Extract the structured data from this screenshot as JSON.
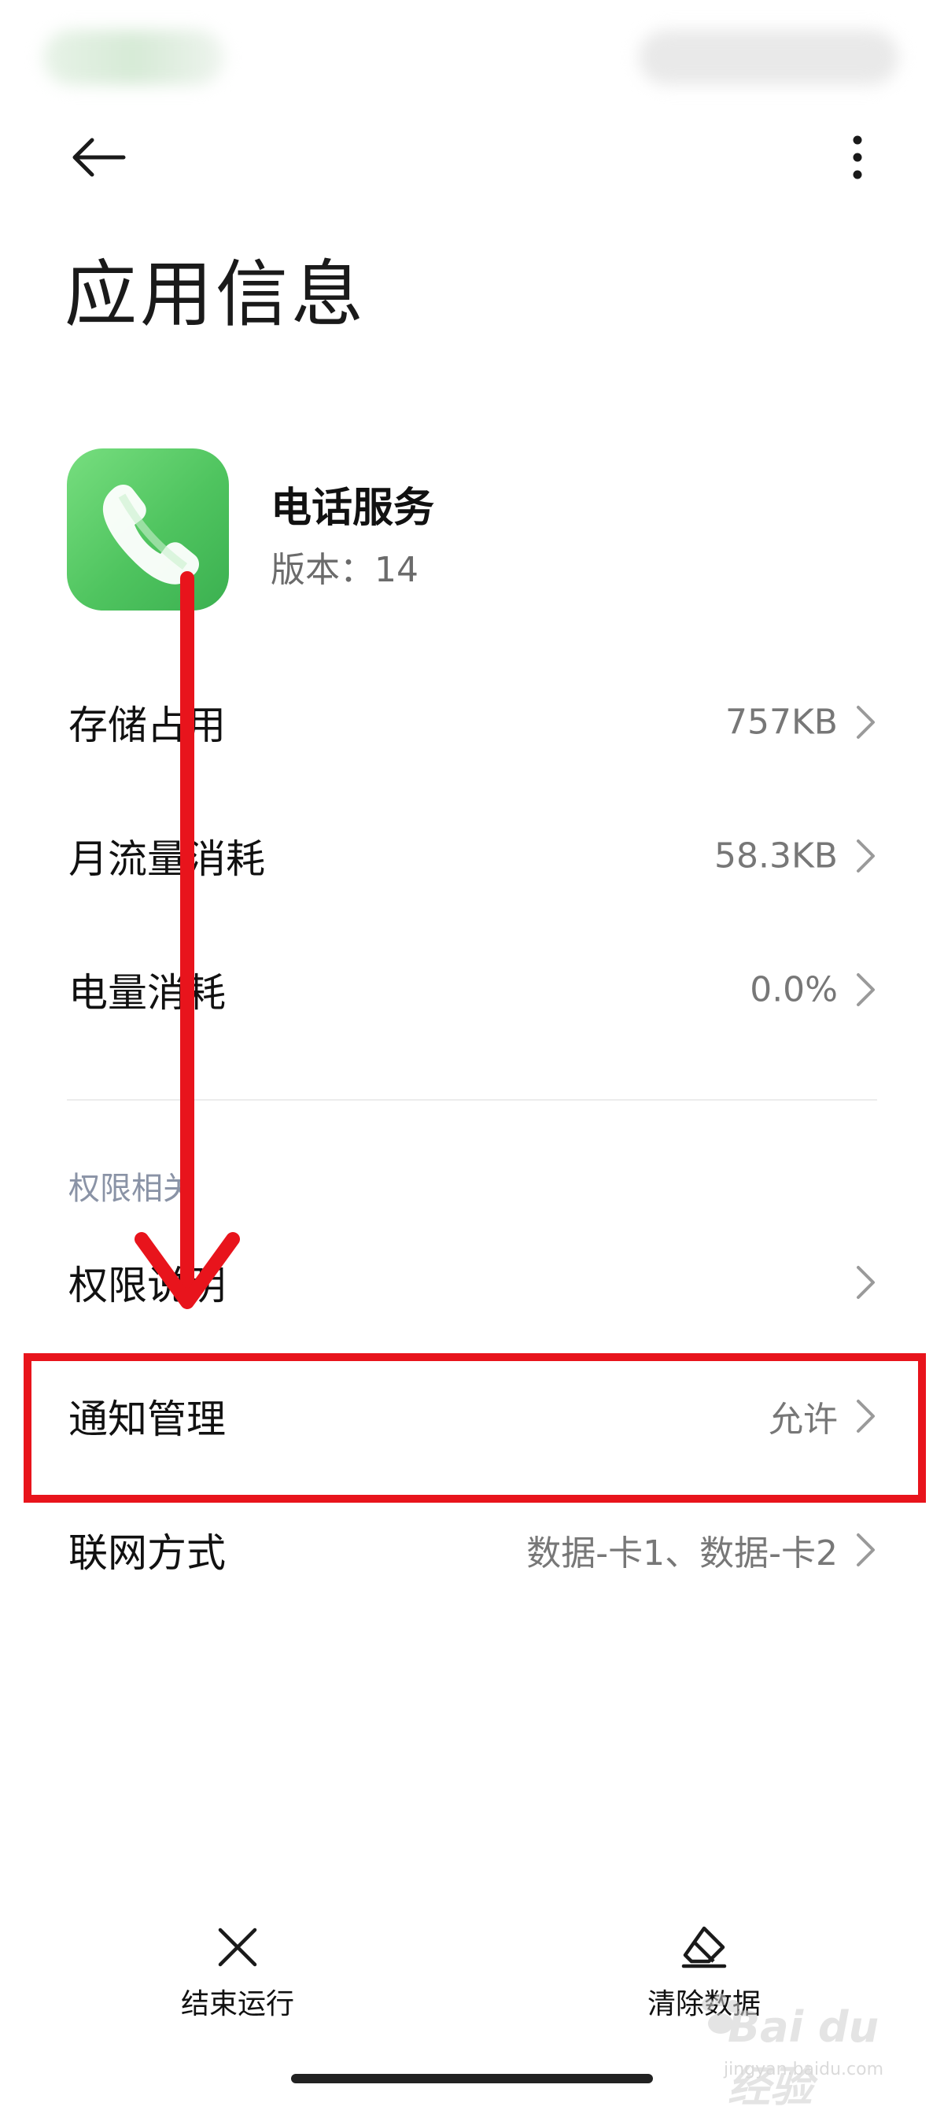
{
  "header": {
    "title": "应用信息"
  },
  "app": {
    "name": "电话服务",
    "version": "版本：14",
    "icon": "phone-icon",
    "icon_color": "#4fc45f"
  },
  "usage_rows": [
    {
      "label": "存储占用",
      "value": "757KB"
    },
    {
      "label": "月流量消耗",
      "value": "58.3KB"
    },
    {
      "label": "电量消耗",
      "value": "0.0%"
    }
  ],
  "permissions_section": {
    "title": "权限相关",
    "rows": [
      {
        "label": "权限说明",
        "value": ""
      },
      {
        "label": "通知管理",
        "value": "允许"
      },
      {
        "label": "联网方式",
        "value": "数据-卡1、数据-卡2"
      }
    ]
  },
  "bottom_actions": {
    "force_stop": "结束运行",
    "clear_data": "清除数据"
  },
  "annotation": {
    "highlight_color": "#e8141c"
  },
  "watermark": {
    "brand": "Bai du 经验",
    "url": "jingyan.baidu.com"
  }
}
